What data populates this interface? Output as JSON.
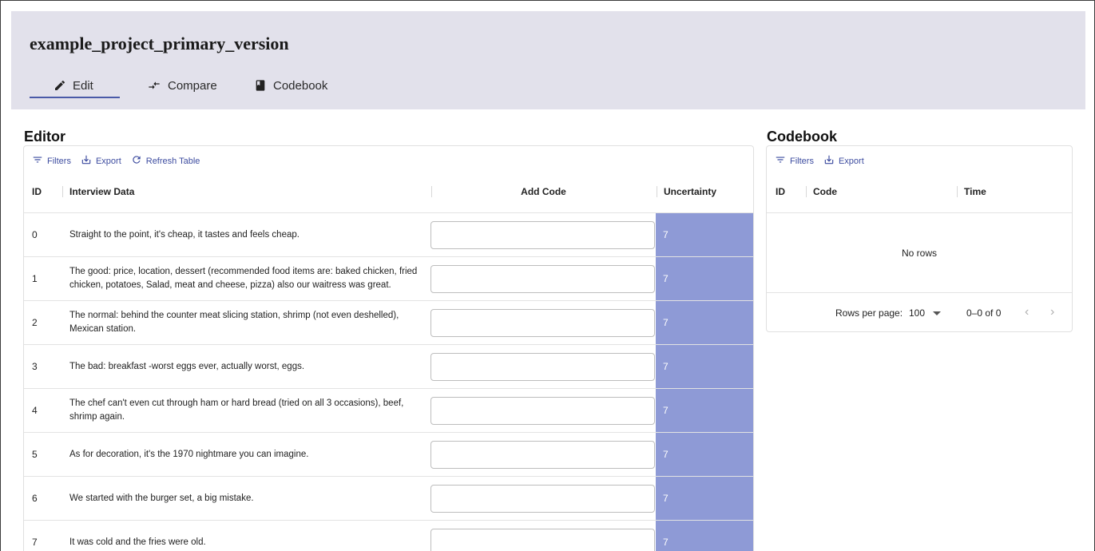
{
  "header": {
    "project_title": "example_project_primary_version",
    "tabs": [
      {
        "label": "Edit",
        "icon": "pencil-icon",
        "active": true
      },
      {
        "label": "Compare",
        "icon": "compare-arrows-icon",
        "active": false
      },
      {
        "label": "Codebook",
        "icon": "book-icon",
        "active": false
      }
    ]
  },
  "editor": {
    "title": "Editor",
    "toolbar": {
      "filters": "Filters",
      "export": "Export",
      "refresh": "Refresh Table"
    },
    "columns": {
      "id": "ID",
      "data": "Interview Data",
      "code": "Add Code",
      "uncertainty": "Uncertainty"
    },
    "rows": [
      {
        "id": "0",
        "text": "Straight to the point, it's cheap, it tastes and feels cheap.",
        "code": "",
        "uncertainty": "7"
      },
      {
        "id": "1",
        "text": "The good: price, location, dessert (recommended food items are: baked chicken, fried chicken, potatoes, Salad, meat and cheese, pizza) also our waitress was great.",
        "code": "",
        "uncertainty": "7"
      },
      {
        "id": "2",
        "text": "The normal: behind the counter meat slicing station, shrimp (not even deshelled), Mexican station.",
        "code": "",
        "uncertainty": "7"
      },
      {
        "id": "3",
        "text": "The bad: breakfast -worst eggs ever, actually worst, eggs.",
        "code": "",
        "uncertainty": "7"
      },
      {
        "id": "4",
        "text": "The chef can't even cut through ham or hard bread (tried on all 3 occasions), beef, shrimp again.",
        "code": "",
        "uncertainty": "7"
      },
      {
        "id": "5",
        "text": "As for decoration, it's the 1970 nightmare you can imagine.",
        "code": "",
        "uncertainty": "7"
      },
      {
        "id": "6",
        "text": "We started with the burger set, a big mistake.",
        "code": "",
        "uncertainty": "7"
      },
      {
        "id": "7",
        "text": "It was cold and the fries were old.",
        "code": "",
        "uncertainty": "7"
      }
    ]
  },
  "codebook": {
    "title": "Codebook",
    "toolbar": {
      "filters": "Filters",
      "export": "Export"
    },
    "columns": {
      "id": "ID",
      "code": "Code",
      "time": "Time"
    },
    "empty_text": "No rows",
    "footer": {
      "rows_per_page_label": "Rows per page:",
      "rows_per_page": "100",
      "range": "0–0 of 0"
    }
  },
  "colors": {
    "header_bg": "#e2e1eb",
    "accent": "#3e4da0",
    "uncertainty_bg": "#8e9ad6"
  }
}
